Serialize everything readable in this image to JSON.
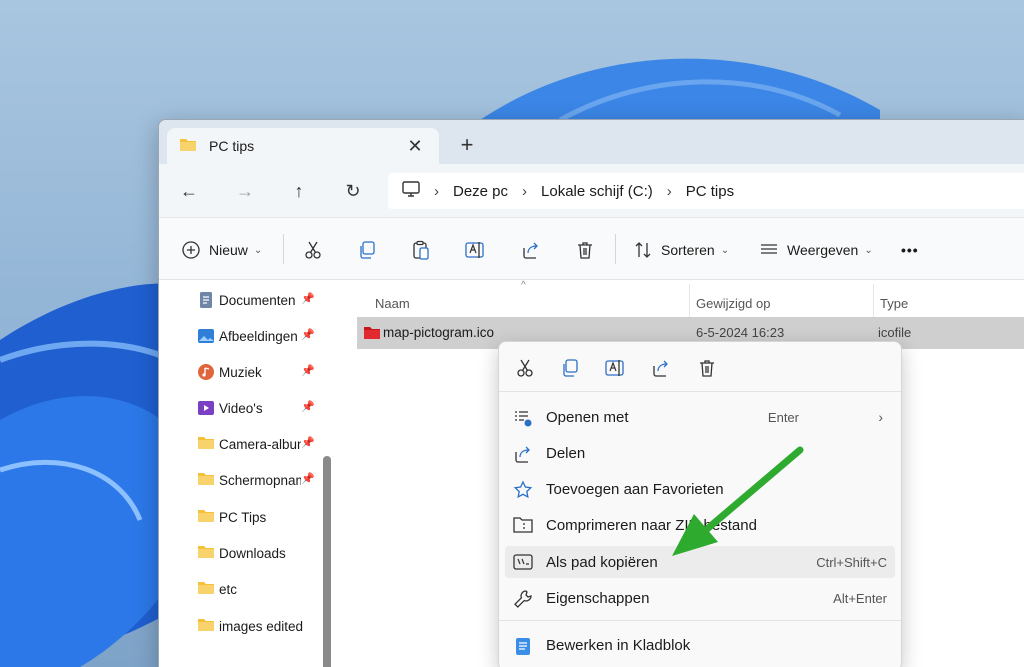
{
  "window": {
    "tab_title": "PC tips",
    "tab_close": "✕",
    "new_tab": "+"
  },
  "nav": {
    "back": "←",
    "forward": "→",
    "up": "↑",
    "refresh": "↻",
    "breadcrumb": [
      "Deze pc",
      "Lokale schijf (C:)",
      "PC tips"
    ],
    "separator": "›"
  },
  "toolbar": {
    "new_label": "Nieuw",
    "sort_label": "Sorteren",
    "view_label": "Weergeven",
    "more_label": "•••"
  },
  "sidebar": {
    "items": [
      {
        "label": "Documenten",
        "icon": "documents-icon",
        "pinned": true
      },
      {
        "label": "Afbeeldingen",
        "icon": "pictures-icon",
        "pinned": true
      },
      {
        "label": "Muziek",
        "icon": "music-icon",
        "pinned": true
      },
      {
        "label": "Video's",
        "icon": "videos-icon",
        "pinned": true
      },
      {
        "label": "Camera-album",
        "icon": "folder-icon",
        "pinned": true
      },
      {
        "label": "Schermopnames",
        "icon": "folder-icon",
        "pinned": true
      },
      {
        "label": "PC Tips",
        "icon": "folder-icon",
        "pinned": false
      },
      {
        "label": "Downloads",
        "icon": "folder-icon",
        "pinned": false
      },
      {
        "label": "etc",
        "icon": "folder-icon",
        "pinned": false
      },
      {
        "label": "images edited",
        "icon": "folder-icon",
        "pinned": false
      }
    ],
    "pin_glyph": "📌"
  },
  "columns": {
    "name": "Naam",
    "modified": "Gewijzigd op",
    "type": "Type"
  },
  "file": {
    "name": "map-pictogram.ico",
    "modified": "6-5-2024 16:23",
    "type": "icofile"
  },
  "context_menu": {
    "items": [
      {
        "label": "Openen met",
        "shortcut": "Enter",
        "chevron": "›",
        "icon": "open-with-icon"
      },
      {
        "label": "Delen",
        "shortcut": "",
        "icon": "share-icon"
      },
      {
        "label": "Toevoegen aan Favorieten",
        "shortcut": "",
        "icon": "star-icon"
      },
      {
        "label": "Comprimeren naar ZIP-bestand",
        "shortcut": "",
        "icon": "zip-folder-icon"
      },
      {
        "label": "Als pad kopiëren",
        "shortcut": "Ctrl+Shift+C",
        "icon": "copy-path-icon"
      },
      {
        "label": "Eigenschappen",
        "shortcut": "Alt+Enter",
        "icon": "wrench-icon"
      },
      {
        "label": "Bewerken in Kladblok",
        "shortcut": "",
        "icon": "notepad-icon"
      }
    ]
  },
  "colors": {
    "accent": "#0067c0",
    "folder": "#f4c23a",
    "annotation_arrow": "#2eaa2e"
  }
}
